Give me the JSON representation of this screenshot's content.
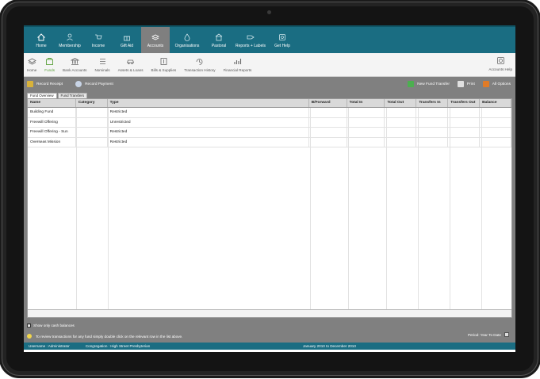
{
  "nav": {
    "items": [
      {
        "label": "Home",
        "icon": "home-icon"
      },
      {
        "label": "Membership",
        "icon": "person-icon"
      },
      {
        "label": "Income",
        "icon": "cart-icon"
      },
      {
        "label": "Gift Aid",
        "icon": "gift-icon"
      },
      {
        "label": "Accounts",
        "icon": "stack-icon",
        "active": true
      },
      {
        "label": "Organisations",
        "icon": "drop-icon"
      },
      {
        "label": "Pastoral",
        "icon": "house-icon"
      },
      {
        "label": "Reports + Labels",
        "icon": "tag-icon"
      },
      {
        "label": "Get Help",
        "icon": "help-icon"
      }
    ]
  },
  "subnav": {
    "items": [
      {
        "label": "Home",
        "icon": "stack-icon"
      },
      {
        "label": "Funds",
        "icon": "funds-icon",
        "active": true
      },
      {
        "label": "Bank Accounts",
        "icon": "bank-icon"
      },
      {
        "label": "Nominals",
        "icon": "list-icon"
      },
      {
        "label": "Assets & Loans",
        "icon": "car-icon"
      },
      {
        "label": "Bills & Supplies",
        "icon": "bill-icon"
      },
      {
        "label": "Transaction History",
        "icon": "history-icon"
      },
      {
        "label": "Financial Reports",
        "icon": "chart-icon"
      }
    ],
    "help_label": "Accounts Help"
  },
  "actions": {
    "record_receipt": "Record Receipt",
    "record_payment": "Record Payment",
    "new_fund_transfer": "New Fund Transfer",
    "print": "Print",
    "all_options": "All Options"
  },
  "tabs": [
    {
      "label": "Fund Overview",
      "active": true
    },
    {
      "label": "Fund Transfers",
      "active": false
    }
  ],
  "table": {
    "columns": [
      "Name",
      "Category",
      "Type",
      "B/Forward",
      "Total In",
      "Total Out",
      "Transfers In",
      "Transfers Out",
      "Balance"
    ],
    "rows": [
      [
        "Building Fund",
        "",
        "Restricted",
        "",
        "",
        "",
        "",
        "",
        ""
      ],
      [
        "Freewill Offering",
        "",
        "Unrestricted",
        "",
        "",
        "",
        "",
        "",
        ""
      ],
      [
        "Freewill Offering - Sun",
        "",
        "Restricted",
        "",
        "",
        "",
        "",
        "",
        ""
      ],
      [
        "Overseas Mission",
        "",
        "Restricted",
        "",
        "",
        "",
        "",
        "",
        ""
      ]
    ]
  },
  "footer": {
    "checkbox_label": "Show only cash balances",
    "tip": "To review transactions for any fund simply double click on the relevant row in the list above.",
    "period_label": "Period: Year To Date"
  },
  "status": {
    "username": "Username : Administrator",
    "congregation": "Congregation : High Street Presbyterian",
    "date_range": "January 2010 to December 2010"
  },
  "colors": {
    "brand": "#1a6d82",
    "active_nav": "#7f7f7f",
    "active_sub": "#5aa03a",
    "panel": "#808080"
  }
}
